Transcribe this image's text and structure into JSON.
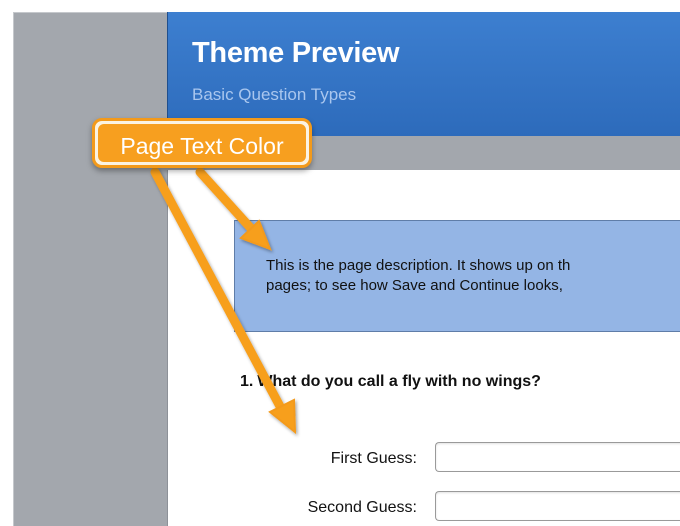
{
  "theme_header": {
    "title": "Theme Preview",
    "subtitle": "Basic Question Types",
    "background_color": "#3372c5"
  },
  "page": {
    "description_line_1": "This is the page description. It shows up on th",
    "description_line_2": "pages; to see how Save and Continue looks, ",
    "description_background": "#94b5e5"
  },
  "question": {
    "number": "1.",
    "text": "What do you call a fly with no wings?",
    "fields": [
      {
        "label": "First Guess:",
        "value": ""
      },
      {
        "label": "Second Guess:",
        "value": ""
      }
    ]
  },
  "annotation": {
    "label": "Page Text Color",
    "color": "#f79f1f"
  }
}
